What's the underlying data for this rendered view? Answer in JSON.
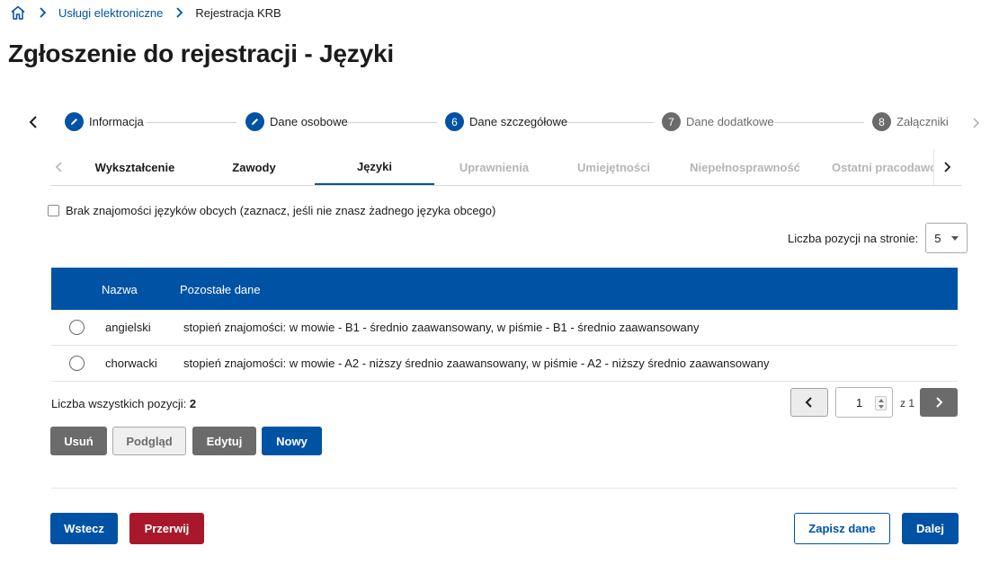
{
  "breadcrumb": {
    "home_icon": "home-icon",
    "items": [
      "Usługi elektroniczne",
      "Rejestracja KRB"
    ]
  },
  "page_title": "Zgłoszenie do rejestracji - Języki",
  "stepper": {
    "steps": [
      {
        "marker": "",
        "label": "Informacja",
        "state": "done"
      },
      {
        "marker": "",
        "label": "Dane osobowe",
        "state": "done"
      },
      {
        "marker": "6",
        "label": "Dane szczegółowe",
        "state": "current"
      },
      {
        "marker": "7",
        "label": "Dane dodatkowe",
        "state": "upcoming"
      },
      {
        "marker": "8",
        "label": "Załączniki",
        "state": "upcoming"
      }
    ]
  },
  "tabs": [
    {
      "label": "Wykształcenie",
      "state": "normal"
    },
    {
      "label": "Zawody",
      "state": "normal"
    },
    {
      "label": "Języki",
      "state": "active"
    },
    {
      "label": "Uprawnienia",
      "state": "disabled"
    },
    {
      "label": "Umiejętności",
      "state": "disabled"
    },
    {
      "label": "Niepełnosprawność",
      "state": "disabled"
    },
    {
      "label": "Ostatni pracodawca",
      "state": "disabled"
    }
  ],
  "no_languages_checkbox": {
    "label": "Brak znajomości języków obcych (zaznacz, jeśli nie znasz żadnego języka obcego)",
    "checked": false
  },
  "per_page": {
    "label": "Liczba pozycji na stronie:",
    "value": "5"
  },
  "table": {
    "headers": [
      "Nazwa",
      "Pozostałe dane"
    ],
    "rows": [
      {
        "name": "angielski",
        "details": "stopień znajomości: w mowie - B1 - średnio zaawansowany, w piśmie - B1 - średnio zaawansowany"
      },
      {
        "name": "chorwacki",
        "details": "stopień znajomości: w mowie - A2 - niższy średnio zaawansowany, w piśmie - A2 - niższy średnio zaawansowany"
      }
    ]
  },
  "total": {
    "label": "Liczba wszystkich pozycji:",
    "value": "2"
  },
  "pagination": {
    "page": "1",
    "of_label": "z 1"
  },
  "actions": {
    "delete": "Usuń",
    "preview": "Podgląd",
    "edit": "Edytuj",
    "new": "Nowy"
  },
  "footer": {
    "back": "Wstecz",
    "abort": "Przerwij",
    "save": "Zapisz dane",
    "next": "Dalej"
  },
  "colors": {
    "primary": "#0052a5",
    "danger": "#a8182a",
    "secondary": "#6b6b6b"
  }
}
